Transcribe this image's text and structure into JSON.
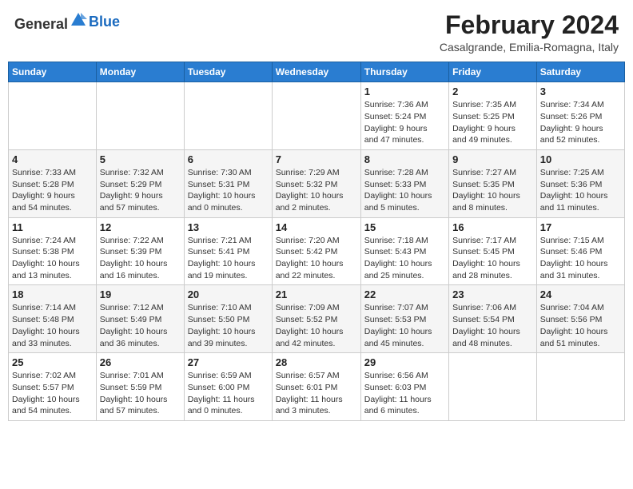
{
  "header": {
    "logo_general": "General",
    "logo_blue": "Blue",
    "month_year": "February 2024",
    "location": "Casalgrande, Emilia-Romagna, Italy"
  },
  "weekdays": [
    "Sunday",
    "Monday",
    "Tuesday",
    "Wednesday",
    "Thursday",
    "Friday",
    "Saturday"
  ],
  "weeks": [
    [
      {
        "day": "",
        "info": ""
      },
      {
        "day": "",
        "info": ""
      },
      {
        "day": "",
        "info": ""
      },
      {
        "day": "",
        "info": ""
      },
      {
        "day": "1",
        "info": "Sunrise: 7:36 AM\nSunset: 5:24 PM\nDaylight: 9 hours\nand 47 minutes."
      },
      {
        "day": "2",
        "info": "Sunrise: 7:35 AM\nSunset: 5:25 PM\nDaylight: 9 hours\nand 49 minutes."
      },
      {
        "day": "3",
        "info": "Sunrise: 7:34 AM\nSunset: 5:26 PM\nDaylight: 9 hours\nand 52 minutes."
      }
    ],
    [
      {
        "day": "4",
        "info": "Sunrise: 7:33 AM\nSunset: 5:28 PM\nDaylight: 9 hours\nand 54 minutes."
      },
      {
        "day": "5",
        "info": "Sunrise: 7:32 AM\nSunset: 5:29 PM\nDaylight: 9 hours\nand 57 minutes."
      },
      {
        "day": "6",
        "info": "Sunrise: 7:30 AM\nSunset: 5:31 PM\nDaylight: 10 hours\nand 0 minutes."
      },
      {
        "day": "7",
        "info": "Sunrise: 7:29 AM\nSunset: 5:32 PM\nDaylight: 10 hours\nand 2 minutes."
      },
      {
        "day": "8",
        "info": "Sunrise: 7:28 AM\nSunset: 5:33 PM\nDaylight: 10 hours\nand 5 minutes."
      },
      {
        "day": "9",
        "info": "Sunrise: 7:27 AM\nSunset: 5:35 PM\nDaylight: 10 hours\nand 8 minutes."
      },
      {
        "day": "10",
        "info": "Sunrise: 7:25 AM\nSunset: 5:36 PM\nDaylight: 10 hours\nand 11 minutes."
      }
    ],
    [
      {
        "day": "11",
        "info": "Sunrise: 7:24 AM\nSunset: 5:38 PM\nDaylight: 10 hours\nand 13 minutes."
      },
      {
        "day": "12",
        "info": "Sunrise: 7:22 AM\nSunset: 5:39 PM\nDaylight: 10 hours\nand 16 minutes."
      },
      {
        "day": "13",
        "info": "Sunrise: 7:21 AM\nSunset: 5:41 PM\nDaylight: 10 hours\nand 19 minutes."
      },
      {
        "day": "14",
        "info": "Sunrise: 7:20 AM\nSunset: 5:42 PM\nDaylight: 10 hours\nand 22 minutes."
      },
      {
        "day": "15",
        "info": "Sunrise: 7:18 AM\nSunset: 5:43 PM\nDaylight: 10 hours\nand 25 minutes."
      },
      {
        "day": "16",
        "info": "Sunrise: 7:17 AM\nSunset: 5:45 PM\nDaylight: 10 hours\nand 28 minutes."
      },
      {
        "day": "17",
        "info": "Sunrise: 7:15 AM\nSunset: 5:46 PM\nDaylight: 10 hours\nand 31 minutes."
      }
    ],
    [
      {
        "day": "18",
        "info": "Sunrise: 7:14 AM\nSunset: 5:48 PM\nDaylight: 10 hours\nand 33 minutes."
      },
      {
        "day": "19",
        "info": "Sunrise: 7:12 AM\nSunset: 5:49 PM\nDaylight: 10 hours\nand 36 minutes."
      },
      {
        "day": "20",
        "info": "Sunrise: 7:10 AM\nSunset: 5:50 PM\nDaylight: 10 hours\nand 39 minutes."
      },
      {
        "day": "21",
        "info": "Sunrise: 7:09 AM\nSunset: 5:52 PM\nDaylight: 10 hours\nand 42 minutes."
      },
      {
        "day": "22",
        "info": "Sunrise: 7:07 AM\nSunset: 5:53 PM\nDaylight: 10 hours\nand 45 minutes."
      },
      {
        "day": "23",
        "info": "Sunrise: 7:06 AM\nSunset: 5:54 PM\nDaylight: 10 hours\nand 48 minutes."
      },
      {
        "day": "24",
        "info": "Sunrise: 7:04 AM\nSunset: 5:56 PM\nDaylight: 10 hours\nand 51 minutes."
      }
    ],
    [
      {
        "day": "25",
        "info": "Sunrise: 7:02 AM\nSunset: 5:57 PM\nDaylight: 10 hours\nand 54 minutes."
      },
      {
        "day": "26",
        "info": "Sunrise: 7:01 AM\nSunset: 5:59 PM\nDaylight: 10 hours\nand 57 minutes."
      },
      {
        "day": "27",
        "info": "Sunrise: 6:59 AM\nSunset: 6:00 PM\nDaylight: 11 hours\nand 0 minutes."
      },
      {
        "day": "28",
        "info": "Sunrise: 6:57 AM\nSunset: 6:01 PM\nDaylight: 11 hours\nand 3 minutes."
      },
      {
        "day": "29",
        "info": "Sunrise: 6:56 AM\nSunset: 6:03 PM\nDaylight: 11 hours\nand 6 minutes."
      },
      {
        "day": "",
        "info": ""
      },
      {
        "day": "",
        "info": ""
      }
    ]
  ]
}
